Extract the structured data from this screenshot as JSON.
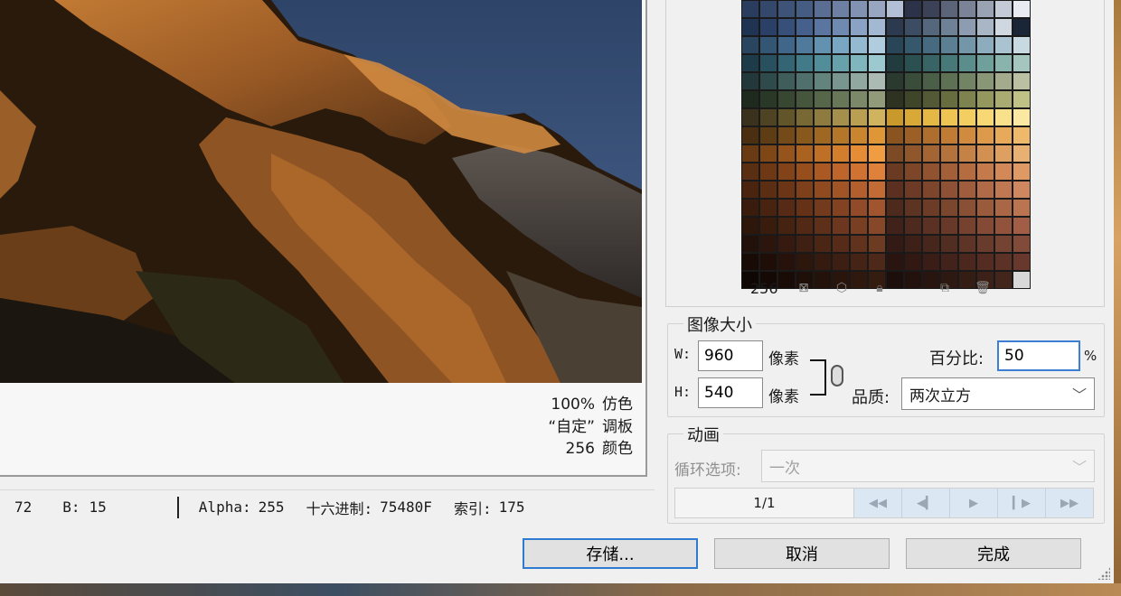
{
  "preview": {
    "info": {
      "zoom": "100%",
      "dither_label": "仿色",
      "palette_name": "“自定”",
      "palette_label": "调板",
      "colors_count": "256",
      "colors_label": "颜色"
    }
  },
  "status": {
    "g_value": "72",
    "b_label": "B:",
    "b_value": "15",
    "alpha_label": "Alpha:",
    "alpha_value": "255",
    "hex_label": "十六进制:",
    "hex_value": "75480F",
    "index_label": "索引:",
    "index_value": "175"
  },
  "color_table": {
    "count": "256",
    "swatches": [
      "#2a3d5e",
      "#34486b",
      "#3d5378",
      "#465d83",
      "#5a6e94",
      "#6d7fa3",
      "#8292b2",
      "#98a6c1",
      "#b3bfd4",
      "#2c3247",
      "#3b4257",
      "#5b6478",
      "#7b8497",
      "#9aa3b4",
      "#c4cad6",
      "#e8ecf2",
      "#1f3352",
      "#2b4066",
      "#37507a",
      "#46608d",
      "#5a76a0",
      "#6f8ab1",
      "#8aa3c4",
      "#a3b8d3",
      "#2b3a4f",
      "#3c4d63",
      "#55677d",
      "#6f8197",
      "#8d9cb0",
      "#a9b6c6",
      "#cfd7e1",
      "#1a2538",
      "#2a4560",
      "#345675",
      "#40678a",
      "#4f7a9b",
      "#6391b0",
      "#79a6c2",
      "#94bad2",
      "#b0cde0",
      "#284658",
      "#35586c",
      "#466b80",
      "#5b8094",
      "#7396a9",
      "#8dadbe",
      "#aac3d0",
      "#c8d9e2",
      "#1e3b4a",
      "#28505f",
      "#336574",
      "#417a88",
      "#528e9a",
      "#67a2ac",
      "#7fb6be",
      "#9bc9cf",
      "#203c3f",
      "#2b5052",
      "#386466",
      "#477979",
      "#5a8d8b",
      "#70a09c",
      "#89b3ad",
      "#a5c5bf",
      "#22383a",
      "#2f4a4a",
      "#3e5d5b",
      "#4f706c",
      "#63837d",
      "#79958f",
      "#91a8a1",
      "#abbbb4",
      "#2b3a2e",
      "#3a4c3a",
      "#4b5e47",
      "#5e7155",
      "#738465",
      "#8a9777",
      "#a3ab8c",
      "#bcc0a3",
      "#1f2a1e",
      "#2a3827",
      "#374731",
      "#46563c",
      "#566649",
      "#687758",
      "#7c8968",
      "#919b7a",
      "#2e3321",
      "#3f4529",
      "#535934",
      "#686d40",
      "#7e824e",
      "#94975e",
      "#aaab70",
      "#c0c184",
      "#3a321c",
      "#4e4322",
      "#63552a",
      "#786834",
      "#8e7b3f",
      "#a4904c",
      "#ba9f52",
      "#d0b35f",
      "#c99a2b",
      "#d8a936",
      "#e3b844",
      "#eec553",
      "#f3cf62",
      "#f7d875",
      "#f9e08a",
      "#fbe8a2",
      "#4a2f10",
      "#5e3c14",
      "#734a18",
      "#88581d",
      "#9e6722",
      "#b47628",
      "#ca862f",
      "#df9637",
      "#8a5320",
      "#9c6026",
      "#ae6e2d",
      "#c07c35",
      "#d08b3f",
      "#dd9a4b",
      "#e7a95a",
      "#efb96c",
      "#6a3a12",
      "#7f4716",
      "#94541b",
      "#a96220",
      "#be7026",
      "#d37e2d",
      "#e48d36",
      "#f09c42",
      "#7c4a24",
      "#8f572b",
      "#a26533",
      "#b4733c",
      "#c48246",
      "#d29152",
      "#dea061",
      "#e8b073",
      "#5a2e10",
      "#6e3814",
      "#824318",
      "#964e1d",
      "#aa5923",
      "#bd652a",
      "#cf7232",
      "#df803b",
      "#6b3a22",
      "#7e4628",
      "#91522f",
      "#a35f37",
      "#b46c40",
      "#c47a4b",
      "#d28957",
      "#df9965",
      "#4a240e",
      "#5b2d12",
      "#6c3616",
      "#7e401b",
      "#8f4a20",
      "#a15426",
      "#b25f2d",
      "#c26b35",
      "#5c3020",
      "#6d3a26",
      "#7e452d",
      "#8f5135",
      "#a05d3e",
      "#b06a48",
      "#c07853",
      "#cf875f",
      "#3a1c0c",
      "#482310",
      "#562a14",
      "#653218",
      "#743a1d",
      "#834222",
      "#924b28",
      "#a1552f",
      "#4e2a1c",
      "#5d3321",
      "#6c3c27",
      "#7b462e",
      "#8a5035",
      "#9a5b3d",
      "#aa6746",
      "#bb7450",
      "#2e160a",
      "#3a1c0d",
      "#462211",
      "#522915",
      "#5f3019",
      "#6c371e",
      "#793f23",
      "#874729",
      "#40221a",
      "#4d291e",
      "#5a3123",
      "#683929",
      "#76412f",
      "#844a36",
      "#92533d",
      "#a15d45",
      "#22100a",
      "#2c150c",
      "#361a0f",
      "#402012",
      "#4b2615",
      "#562c19",
      "#61331d",
      "#6d3a22",
      "#331a14",
      "#3d2018",
      "#47261c",
      "#522d21",
      "#5d3426",
      "#693b2c",
      "#754332",
      "#824b39",
      "#180b06",
      "#1f0e08",
      "#26120a",
      "#2d160c",
      "#351a0f",
      "#3d1e12",
      "#452315",
      "#4e2818",
      "#2a1410",
      "#321813",
      "#3a1d16",
      "#42221a",
      "#4b271e",
      "#542c22",
      "#5d3226",
      "#67382b",
      "#0f0704",
      "#140905",
      "#190c07",
      "#1e0f08",
      "#23120a",
      "#29150c",
      "#2f180e",
      "#351c10",
      "#1c0e0b",
      "#22110d",
      "#28150f",
      "#2e1912",
      "#341d15",
      "#3b2118",
      "#42261b",
      "#d8d8d8"
    ]
  },
  "image_size": {
    "title": "图像大小",
    "w_label": "W:",
    "h_label": "H:",
    "width": "960",
    "height": "540",
    "unit_w": "像素",
    "unit_h": "像素",
    "percent_label": "百分比:",
    "percent_value": "50",
    "percent_unit": "%",
    "quality_label": "品质:",
    "quality_value": "两次立方"
  },
  "animation": {
    "title": "动画",
    "loop_label": "循环选项:",
    "loop_value": "一次",
    "frame_counter": "1/1"
  },
  "buttons": {
    "save": "存储...",
    "cancel": "取消",
    "done": "完成"
  },
  "colors": {
    "accent": "#2f7bd1",
    "dialog_bg": "#f0f0f0"
  }
}
